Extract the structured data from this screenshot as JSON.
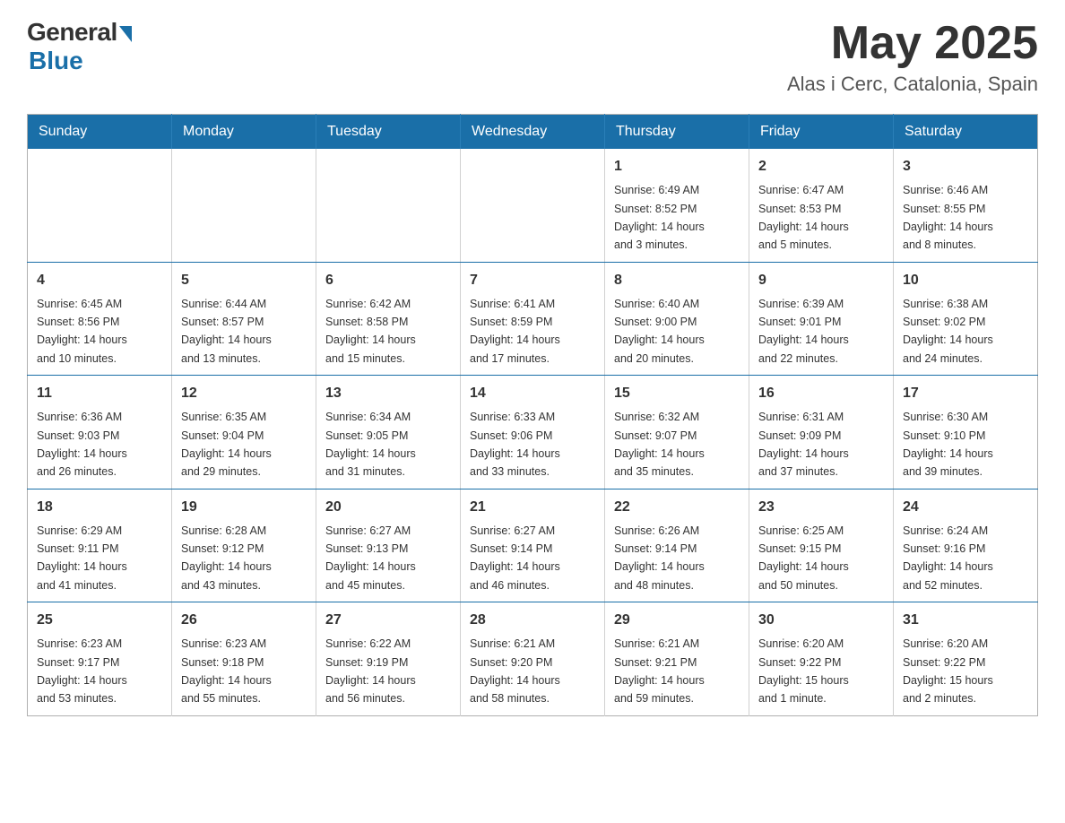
{
  "header": {
    "logo_general": "General",
    "logo_blue": "Blue",
    "month": "May 2025",
    "location": "Alas i Cerc, Catalonia, Spain"
  },
  "days_of_week": [
    "Sunday",
    "Monday",
    "Tuesday",
    "Wednesday",
    "Thursday",
    "Friday",
    "Saturday"
  ],
  "weeks": [
    [
      {
        "day": "",
        "info": ""
      },
      {
        "day": "",
        "info": ""
      },
      {
        "day": "",
        "info": ""
      },
      {
        "day": "",
        "info": ""
      },
      {
        "day": "1",
        "info": "Sunrise: 6:49 AM\nSunset: 8:52 PM\nDaylight: 14 hours\nand 3 minutes."
      },
      {
        "day": "2",
        "info": "Sunrise: 6:47 AM\nSunset: 8:53 PM\nDaylight: 14 hours\nand 5 minutes."
      },
      {
        "day": "3",
        "info": "Sunrise: 6:46 AM\nSunset: 8:55 PM\nDaylight: 14 hours\nand 8 minutes."
      }
    ],
    [
      {
        "day": "4",
        "info": "Sunrise: 6:45 AM\nSunset: 8:56 PM\nDaylight: 14 hours\nand 10 minutes."
      },
      {
        "day": "5",
        "info": "Sunrise: 6:44 AM\nSunset: 8:57 PM\nDaylight: 14 hours\nand 13 minutes."
      },
      {
        "day": "6",
        "info": "Sunrise: 6:42 AM\nSunset: 8:58 PM\nDaylight: 14 hours\nand 15 minutes."
      },
      {
        "day": "7",
        "info": "Sunrise: 6:41 AM\nSunset: 8:59 PM\nDaylight: 14 hours\nand 17 minutes."
      },
      {
        "day": "8",
        "info": "Sunrise: 6:40 AM\nSunset: 9:00 PM\nDaylight: 14 hours\nand 20 minutes."
      },
      {
        "day": "9",
        "info": "Sunrise: 6:39 AM\nSunset: 9:01 PM\nDaylight: 14 hours\nand 22 minutes."
      },
      {
        "day": "10",
        "info": "Sunrise: 6:38 AM\nSunset: 9:02 PM\nDaylight: 14 hours\nand 24 minutes."
      }
    ],
    [
      {
        "day": "11",
        "info": "Sunrise: 6:36 AM\nSunset: 9:03 PM\nDaylight: 14 hours\nand 26 minutes."
      },
      {
        "day": "12",
        "info": "Sunrise: 6:35 AM\nSunset: 9:04 PM\nDaylight: 14 hours\nand 29 minutes."
      },
      {
        "day": "13",
        "info": "Sunrise: 6:34 AM\nSunset: 9:05 PM\nDaylight: 14 hours\nand 31 minutes."
      },
      {
        "day": "14",
        "info": "Sunrise: 6:33 AM\nSunset: 9:06 PM\nDaylight: 14 hours\nand 33 minutes."
      },
      {
        "day": "15",
        "info": "Sunrise: 6:32 AM\nSunset: 9:07 PM\nDaylight: 14 hours\nand 35 minutes."
      },
      {
        "day": "16",
        "info": "Sunrise: 6:31 AM\nSunset: 9:09 PM\nDaylight: 14 hours\nand 37 minutes."
      },
      {
        "day": "17",
        "info": "Sunrise: 6:30 AM\nSunset: 9:10 PM\nDaylight: 14 hours\nand 39 minutes."
      }
    ],
    [
      {
        "day": "18",
        "info": "Sunrise: 6:29 AM\nSunset: 9:11 PM\nDaylight: 14 hours\nand 41 minutes."
      },
      {
        "day": "19",
        "info": "Sunrise: 6:28 AM\nSunset: 9:12 PM\nDaylight: 14 hours\nand 43 minutes."
      },
      {
        "day": "20",
        "info": "Sunrise: 6:27 AM\nSunset: 9:13 PM\nDaylight: 14 hours\nand 45 minutes."
      },
      {
        "day": "21",
        "info": "Sunrise: 6:27 AM\nSunset: 9:14 PM\nDaylight: 14 hours\nand 46 minutes."
      },
      {
        "day": "22",
        "info": "Sunrise: 6:26 AM\nSunset: 9:14 PM\nDaylight: 14 hours\nand 48 minutes."
      },
      {
        "day": "23",
        "info": "Sunrise: 6:25 AM\nSunset: 9:15 PM\nDaylight: 14 hours\nand 50 minutes."
      },
      {
        "day": "24",
        "info": "Sunrise: 6:24 AM\nSunset: 9:16 PM\nDaylight: 14 hours\nand 52 minutes."
      }
    ],
    [
      {
        "day": "25",
        "info": "Sunrise: 6:23 AM\nSunset: 9:17 PM\nDaylight: 14 hours\nand 53 minutes."
      },
      {
        "day": "26",
        "info": "Sunrise: 6:23 AM\nSunset: 9:18 PM\nDaylight: 14 hours\nand 55 minutes."
      },
      {
        "day": "27",
        "info": "Sunrise: 6:22 AM\nSunset: 9:19 PM\nDaylight: 14 hours\nand 56 minutes."
      },
      {
        "day": "28",
        "info": "Sunrise: 6:21 AM\nSunset: 9:20 PM\nDaylight: 14 hours\nand 58 minutes."
      },
      {
        "day": "29",
        "info": "Sunrise: 6:21 AM\nSunset: 9:21 PM\nDaylight: 14 hours\nand 59 minutes."
      },
      {
        "day": "30",
        "info": "Sunrise: 6:20 AM\nSunset: 9:22 PM\nDaylight: 15 hours\nand 1 minute."
      },
      {
        "day": "31",
        "info": "Sunrise: 6:20 AM\nSunset: 9:22 PM\nDaylight: 15 hours\nand 2 minutes."
      }
    ]
  ]
}
